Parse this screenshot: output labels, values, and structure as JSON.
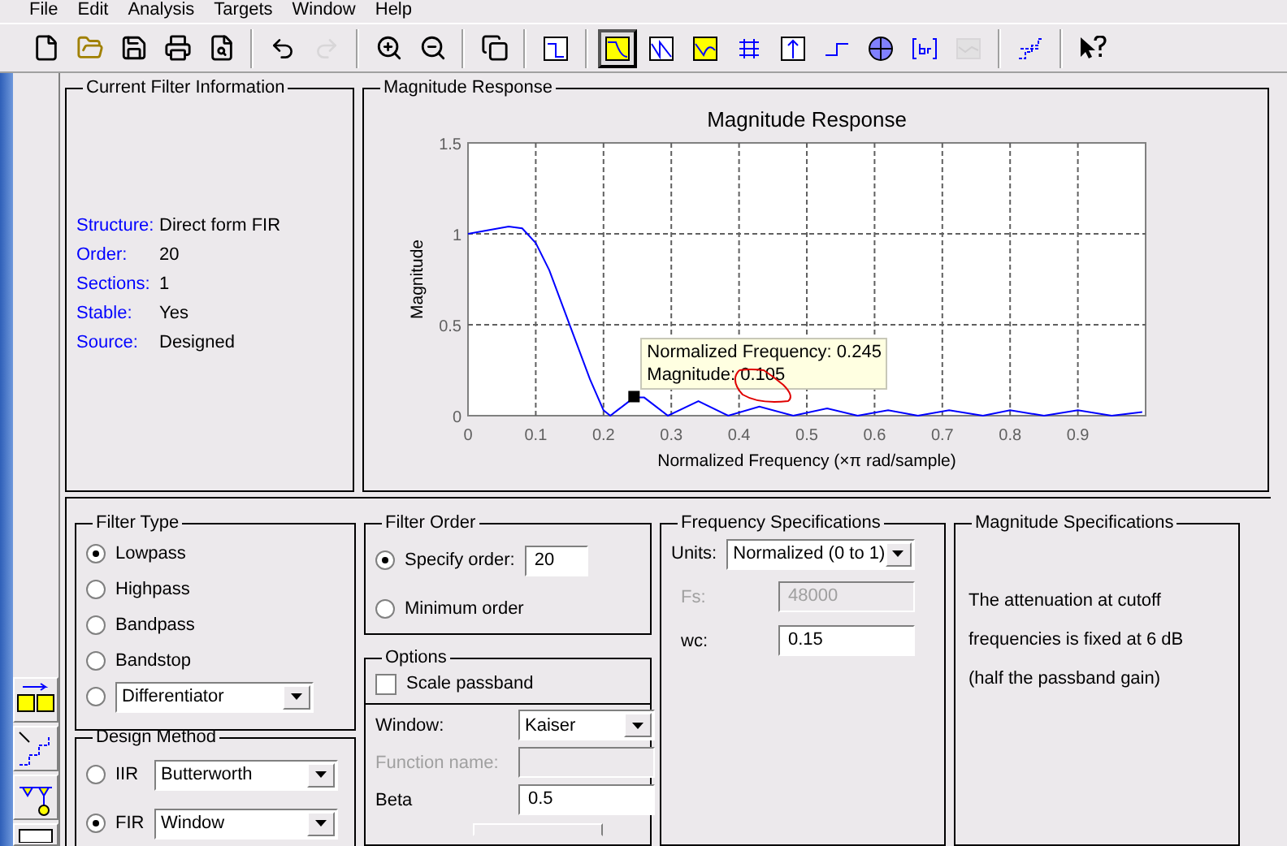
{
  "menu": [
    "File",
    "Edit",
    "Analysis",
    "Targets",
    "Window",
    "Help"
  ],
  "toolbar": [
    [
      {
        "kind": "new",
        "selected": false,
        "disabled": false
      },
      {
        "kind": "open",
        "selected": false,
        "disabled": false
      },
      {
        "kind": "save",
        "selected": false,
        "disabled": false
      },
      {
        "kind": "print",
        "selected": false,
        "disabled": false
      },
      {
        "kind": "preview",
        "selected": false,
        "disabled": false
      }
    ],
    [
      {
        "kind": "undo",
        "selected": false,
        "disabled": false
      },
      {
        "kind": "redo",
        "selected": false,
        "disabled": true
      }
    ],
    [
      {
        "kind": "zoomin",
        "selected": false,
        "disabled": false
      },
      {
        "kind": "zoomout",
        "selected": false,
        "disabled": false
      }
    ],
    [
      {
        "kind": "newwin",
        "selected": false,
        "disabled": false
      }
    ],
    [
      {
        "kind": "spec",
        "selected": false,
        "disabled": false
      }
    ],
    [
      {
        "kind": "magnitude",
        "selected": true,
        "disabled": false
      },
      {
        "kind": "phase",
        "selected": false,
        "disabled": false
      },
      {
        "kind": "magphase",
        "selected": false,
        "disabled": false
      },
      {
        "kind": "delay",
        "selected": false,
        "disabled": false
      },
      {
        "kind": "impulse",
        "selected": false,
        "disabled": false
      },
      {
        "kind": "step",
        "selected": false,
        "disabled": false
      },
      {
        "kind": "polezero",
        "selected": false,
        "disabled": false
      },
      {
        "kind": "coeffs",
        "selected": false,
        "disabled": false
      },
      {
        "kind": "info",
        "selected": false,
        "disabled": true
      }
    ],
    [
      {
        "kind": "quantize",
        "selected": false,
        "disabled": false
      }
    ],
    [
      {
        "kind": "help",
        "selected": false,
        "disabled": false
      }
    ]
  ],
  "filter_info": {
    "title": "Current Filter Information",
    "rows": [
      {
        "label": "Structure:",
        "value": "Direct form FIR"
      },
      {
        "label": "Order:",
        "value": "20"
      },
      {
        "label": "Sections:",
        "value": "1"
      },
      {
        "label": "Stable:",
        "value": "Yes"
      },
      {
        "label": "Source:",
        "value": "Designed"
      }
    ]
  },
  "magnitude_response": {
    "title": "Magnitude Response",
    "chart_data": {
      "type": "line",
      "title": "Magnitude Response",
      "xlabel": "Normalized Frequency  (×π rad/sample)",
      "ylabel": "Magnitude",
      "xlim": [
        0,
        1
      ],
      "ylim": [
        0,
        1.5
      ],
      "xticks": [
        0,
        0.1,
        0.2,
        0.3,
        0.4,
        0.5,
        0.6,
        0.7,
        0.8,
        0.9
      ],
      "yticks": [
        0,
        0.5,
        1,
        1.5
      ],
      "x": [
        0,
        0.03,
        0.06,
        0.08,
        0.1,
        0.12,
        0.14,
        0.16,
        0.18,
        0.2,
        0.21,
        0.245,
        0.26,
        0.295,
        0.34,
        0.384,
        0.43,
        0.48,
        0.53,
        0.575,
        0.62,
        0.664,
        0.71,
        0.76,
        0.8,
        0.85,
        0.9,
        0.95,
        0.995
      ],
      "grid": true,
      "series": [
        {
          "color": "#0000ff",
          "values": [
            1,
            1.02,
            1.04,
            1.03,
            0.95,
            0.8,
            0.6,
            0.4,
            0.2,
            0.03,
            0,
            0.1,
            0.1,
            0,
            0.08,
            0,
            0.05,
            0,
            0.04,
            0,
            0.03,
            0,
            0.03,
            0,
            0.03,
            0,
            0.03,
            0,
            0.02
          ]
        }
      ],
      "annotations": [
        {
          "x": 0.245,
          "y": 0.105,
          "text": "Normalized Frequency: 0.245"
        },
        {
          "x": 0.245,
          "y": 0.105,
          "text": "Magnitude: 0.105"
        }
      ]
    }
  },
  "filter_type": {
    "title": "Filter Type",
    "options": [
      {
        "kind": "radio",
        "label": "Lowpass",
        "selected": true
      },
      {
        "kind": "radio",
        "label": "Highpass",
        "selected": false
      },
      {
        "kind": "radio",
        "label": "Bandpass",
        "selected": false
      },
      {
        "kind": "radio",
        "label": "Bandstop",
        "selected": false
      },
      {
        "kind": "dropdown",
        "label": "Differentiator",
        "selected": false
      }
    ]
  },
  "design_method": {
    "title": "Design Method",
    "options": [
      {
        "label": "IIR",
        "value": "Butterworth",
        "selected": false
      },
      {
        "label": "FIR",
        "value": "Window",
        "selected": true
      }
    ]
  },
  "filter_order": {
    "title": "Filter Order",
    "options": [
      {
        "label": "Specify order:",
        "value": "20",
        "selected": true
      },
      {
        "label": "Minimum order",
        "selected": false
      }
    ]
  },
  "options": {
    "title": "Options",
    "scale_passband": {
      "label": "Scale passband",
      "checked": false
    },
    "fields": [
      {
        "kind": "dropdown",
        "label": "Window:",
        "value": "Kaiser",
        "disabled": false
      },
      {
        "kind": "text",
        "label": "Function name:",
        "disabled": true
      },
      {
        "kind": "text",
        "label": "Beta",
        "value": "0.5",
        "disabled": false
      }
    ]
  },
  "frequency_specs": {
    "title": "Frequency Specifications",
    "units_label": "Units:",
    "units": "Normalized (0 to 1)",
    "fields": [
      {
        "label": "Fs:",
        "value": "48000",
        "disabled": true
      },
      {
        "label": "wc:",
        "value": "0.15",
        "disabled": false
      }
    ]
  },
  "magnitude_specs": {
    "title": "Magnitude Specifications",
    "lines": [
      "The attenuation at cutoff",
      "frequencies is fixed at 6 dB",
      "(half the passband gain)"
    ]
  }
}
